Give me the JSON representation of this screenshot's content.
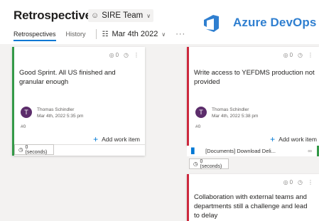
{
  "header": {
    "title": "Retrospectives",
    "team": "SIRE Team",
    "brand": "Azure DevOps",
    "tabs": [
      {
        "label": "Retrospectives",
        "active": true
      },
      {
        "label": "History",
        "active": false
      }
    ],
    "board_date": "Mar 4th 2022",
    "more": "···"
  },
  "colors": {
    "went_well": "#339947",
    "to_improve": "#cc293d",
    "accent": "#0078d4",
    "brand": "#2f7fd0",
    "avatar": "#5c2d6b"
  },
  "cards": [
    {
      "text": "Good Sprint. All US finished and granular enough",
      "votes": "0",
      "author_initial": "T",
      "author": "Thomas Schindler",
      "date": "Mar 4th, 2022 5:35 pm",
      "id": "#0",
      "add_work_item": "Add work item",
      "timer": "0 (seconds)"
    },
    {
      "text": "Write access to YEFDMS production not provided",
      "votes": "0",
      "author_initial": "T",
      "author": "Thomas Schindler",
      "date": "Mar 4th, 2022 5:38 pm",
      "id": "#0",
      "add_work_item": "Add work item",
      "linked_item": "[Documents] Download Deli...",
      "timer": "0 (seconds)"
    },
    {
      "text": "Collaboration with external teams and departments still a challenge and lead to delay",
      "votes": "0"
    }
  ]
}
